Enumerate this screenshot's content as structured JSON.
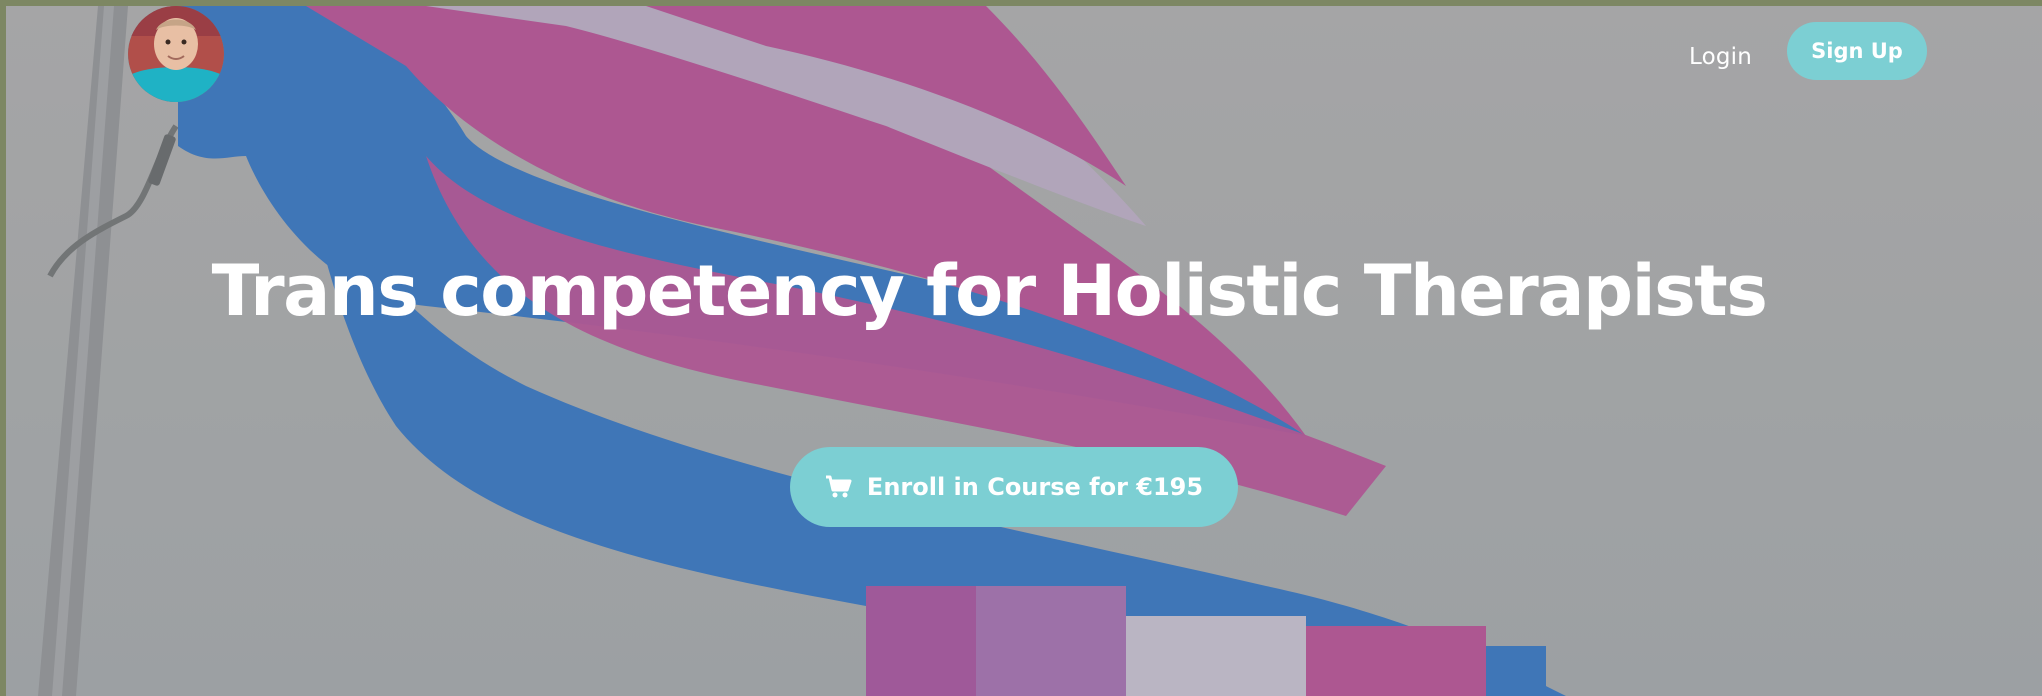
{
  "header": {
    "avatar_icon": "instructor-avatar",
    "login_label": "Login",
    "signup_label": "Sign Up"
  },
  "hero": {
    "background_icon": "trans-pride-flag-photo",
    "title": "Trans competency for Holistic Therapists",
    "enroll_label": "Enroll in Course for €195",
    "enroll_icon": "shopping-cart-icon"
  },
  "colors": {
    "accent": "#7ccfd3",
    "flag_blue": "#2a6fc0",
    "flag_pink": "#b0458f",
    "flag_white": "#c8b6cf",
    "background_gray": "#a9a9aa"
  }
}
